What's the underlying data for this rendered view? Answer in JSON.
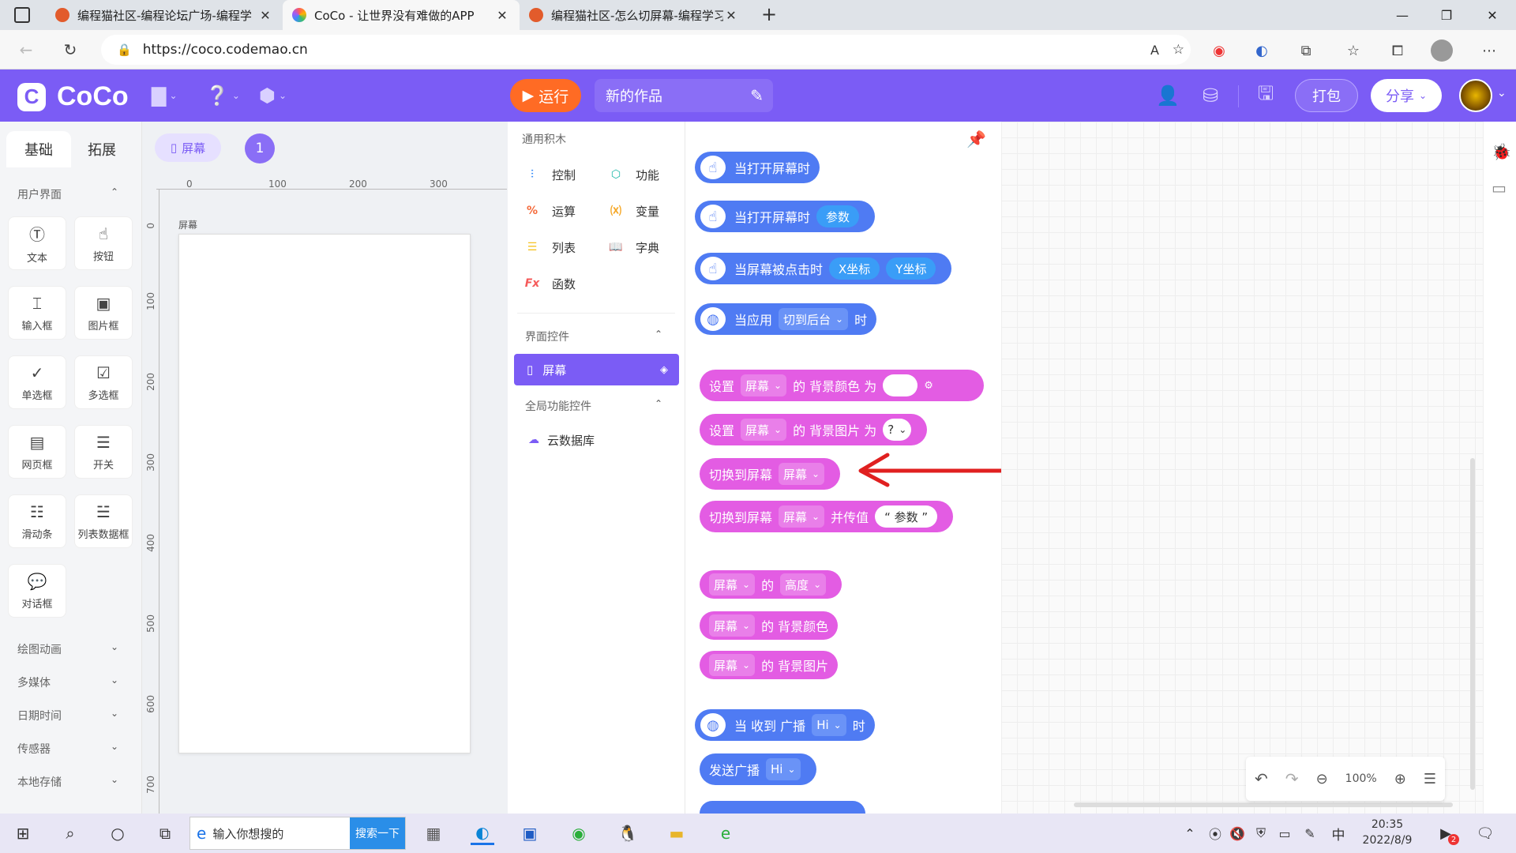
{
  "browser": {
    "tabs": [
      {
        "title": "编程猫社区-编程论坛广场-编程学",
        "active": false
      },
      {
        "title": "CoCo - 让世界没有难做的APP",
        "active": true
      },
      {
        "title": "编程猫社区-怎么切屏幕-编程学习",
        "active": false
      }
    ],
    "url": "https://coco.codemao.cn"
  },
  "header": {
    "app_name": "CoCo",
    "run_label": "运行",
    "project_name": "新的作品",
    "pack_label": "打包",
    "share_label": "分享"
  },
  "left_panel": {
    "tabs": [
      "基础",
      "拓展"
    ],
    "section_user_interface": "用户界面",
    "widgets": [
      "文本",
      "按钮",
      "输入框",
      "图片框",
      "单选框",
      "多选框",
      "网页框",
      "开关",
      "滑动条",
      "列表数据框",
      "对话框"
    ],
    "sections": [
      "绘图动画",
      "多媒体",
      "日期时间",
      "传感器",
      "本地存储"
    ]
  },
  "canvas": {
    "screen_chip": "屏幕",
    "screen_count": "1",
    "screen_label": "屏幕",
    "h_ticks": [
      "0",
      "100",
      "200",
      "300"
    ],
    "v_ticks": [
      "0",
      "100",
      "200",
      "300",
      "400",
      "500",
      "600",
      "700"
    ]
  },
  "categories": {
    "general_header": "通用积木",
    "items": [
      "控制",
      "功能",
      "运算",
      "变量",
      "列表",
      "字典",
      "函数"
    ],
    "ui_controls_header": "界面控件",
    "selected_item": "屏幕",
    "global_header": "全局功能控件",
    "global_item": "云数据库"
  },
  "blocks": {
    "b1": "当打开屏幕时",
    "b2": "当打开屏幕时",
    "b2_param": "参数",
    "b3": "当屏幕被点击时",
    "b3_x": "X坐标",
    "b3_y": "Y坐标",
    "b4_a": "当应用",
    "b4_opt": "切到后台",
    "b4_b": "时",
    "set": "设置",
    "screen": "屏幕",
    "bgcolor_for": "的 背景颜色 为",
    "bgimg_for": "的 背景图片 为",
    "q": "?",
    "switch": "切换到屏幕",
    "switch_pass": "并传值",
    "param_quote": "“ 参数 ”",
    "of": "的",
    "height": "高度",
    "bgcolor": "的 背景颜色",
    "bgimg": "的 背景图片",
    "recv_a": "当 收到 广播",
    "hi": "Hi",
    "recv_b": "时",
    "send": "发送广播"
  },
  "zoom": {
    "level": "100%"
  },
  "taskbar": {
    "search_placeholder": "输入你想搜的",
    "search_button": "搜索一下",
    "time": "20:35",
    "date": "2022/8/9",
    "ime": "中",
    "badge": "2"
  },
  "colors": {
    "brand": "#7b5cf5",
    "run": "#ff6b24",
    "event_block": "#4f7bf3",
    "screen_block": "#e35ce3",
    "annotation_arrow": "#e02020"
  }
}
